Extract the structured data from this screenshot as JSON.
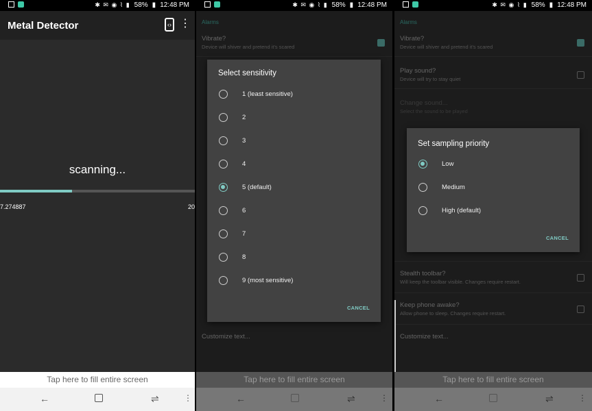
{
  "status_bar": {
    "battery": "58%",
    "time": "12:48 PM"
  },
  "main": {
    "app_title": "Metal Detector",
    "scanning_text": "scanning...",
    "progress": 0.37,
    "reading_left": "7.274887",
    "reading_right": "20"
  },
  "tap_bar": {
    "label": "Tap here to fill entire screen"
  },
  "settings": {
    "cat_alarms": "Alarms",
    "vibrate_title": "Vibrate?",
    "vibrate_sub": "Device will shiver and pretend it's scared",
    "play_sound_title": "Play sound?",
    "play_sound_sub": "Device will try to stay quiet",
    "change_sound_title": "Change sound...",
    "change_sound_sub": "Select the sound to be played",
    "stealth_title": "Stealth toolbar?",
    "stealth_sub": "Will keep the toolbar visible. Changes require restart.",
    "keep_awake_title": "Keep phone awake?",
    "keep_awake_sub": "Allow phone to sleep. Changes require restart.",
    "customize_title": "Customize text..."
  },
  "sensitivity_dialog": {
    "title": "Select sensitivity",
    "options": [
      "1 (least sensitive)",
      "2",
      "3",
      "4",
      "5 (default)",
      "6",
      "7",
      "8",
      "9 (most sensitive)"
    ],
    "selected_index": 4,
    "cancel": "CANCEL"
  },
  "sampling_dialog": {
    "title": "Set sampling priority",
    "options": [
      "Low",
      "Medium",
      "High (default)"
    ],
    "selected_index": 0,
    "cancel": "CANCEL"
  },
  "colors": {
    "accent": "#80cbc4",
    "dialog_bg": "#424242",
    "toolbar": "#212121"
  }
}
